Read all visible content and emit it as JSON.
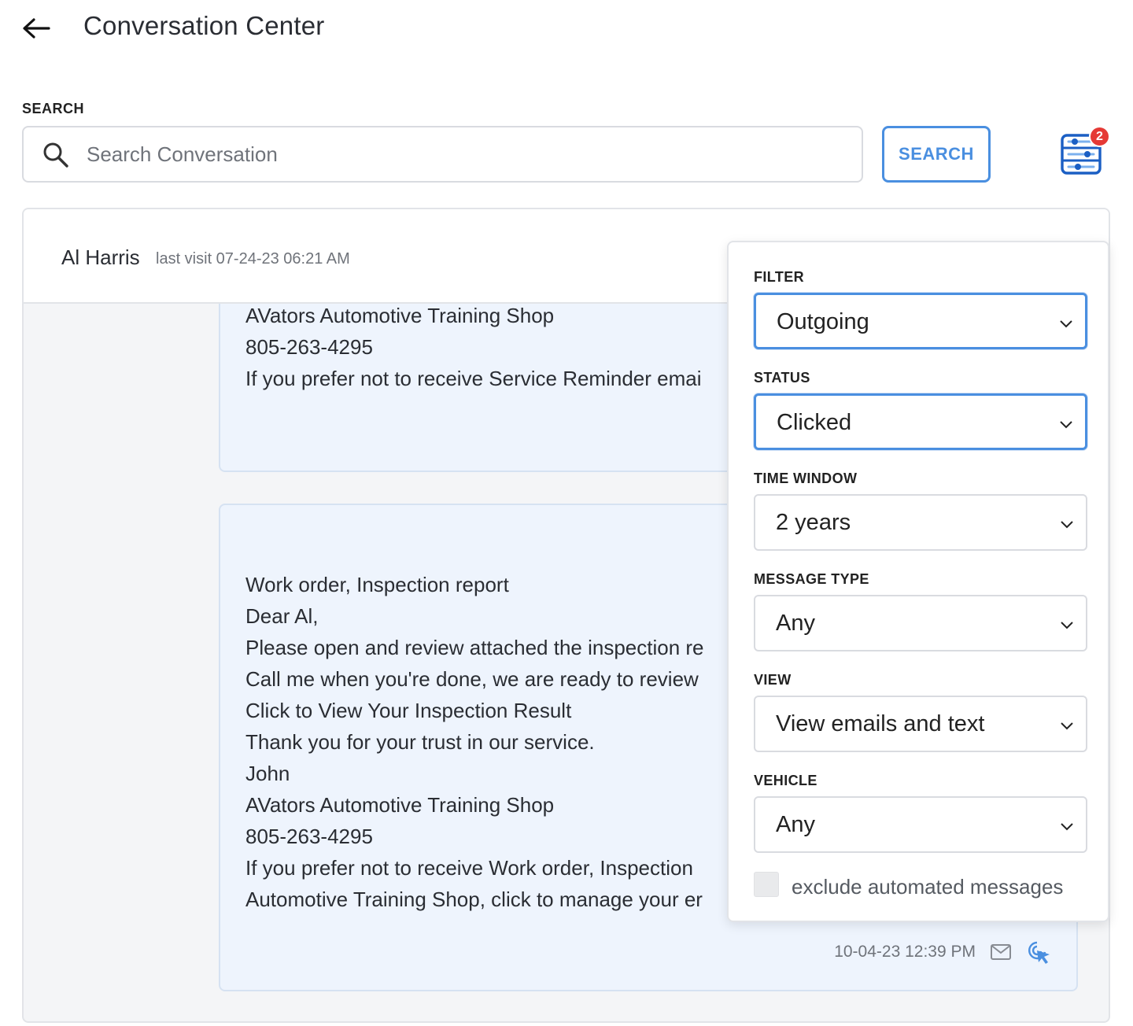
{
  "header": {
    "title": "Conversation Center"
  },
  "search": {
    "label": "SEARCH",
    "placeholder": "Search Conversation",
    "value": "",
    "button_label": "SEARCH",
    "active_filter_count": "2"
  },
  "conversation": {
    "contact_name": "Al Harris",
    "last_visit": "last visit 07-24-23 06:21 AM",
    "messages": [
      {
        "lines": [
          "AVators Automotive Training Shop",
          "805-263-4295",
          "If you prefer not to receive Service Reminder emai"
        ]
      },
      {
        "lines": [
          "Work order, Inspection report",
          "Dear Al,",
          "Please open and review attached the inspection re",
          "Call me when you're done, we are ready to review",
          "Click to View Your Inspection Result",
          "Thank you for your trust in our service.",
          "John",
          "AVators Automotive Training Shop",
          "805-263-4295",
          "If you prefer not to receive Work order, Inspection",
          "Automotive Training Shop, click to manage your er"
        ],
        "timestamp": "10-04-23 12:39 PM",
        "channel_icon": "mail-icon",
        "status_icon": "click-cursor-icon"
      }
    ]
  },
  "filters": {
    "filter": {
      "label": "FILTER",
      "value": "Outgoing"
    },
    "status": {
      "label": "STATUS",
      "value": "Clicked"
    },
    "time_window": {
      "label": "TIME WINDOW",
      "value": "2 years"
    },
    "message_type": {
      "label": "MESSAGE TYPE",
      "value": "Any"
    },
    "view": {
      "label": "VIEW",
      "value": "View emails and text"
    },
    "vehicle": {
      "label": "VEHICLE",
      "value": "Any"
    },
    "exclude_automated": {
      "label": "exclude automated messages",
      "checked": false
    }
  },
  "colors": {
    "accent": "#4a8fe0",
    "badge": "#e53935",
    "message_bg": "#eef4fd"
  }
}
